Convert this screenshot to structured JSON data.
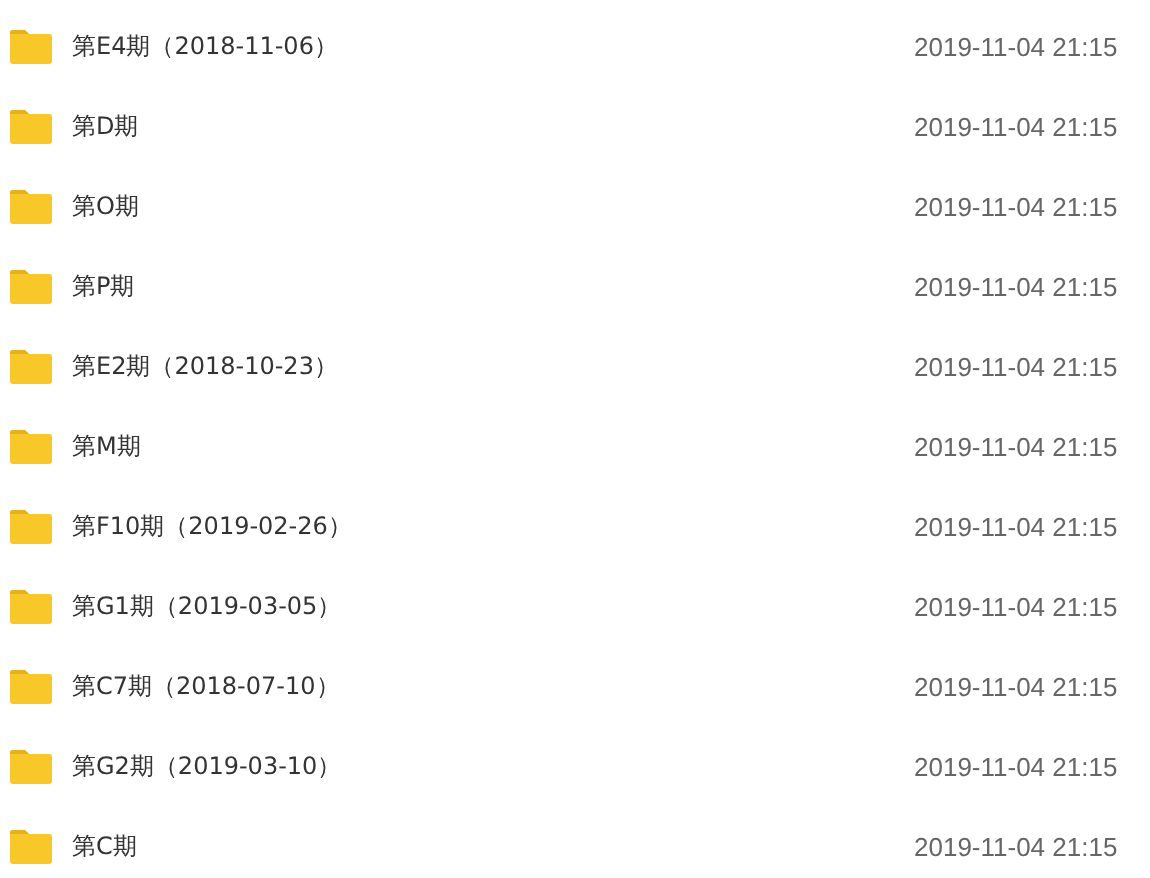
{
  "files": [
    {
      "name": "第E4期（2018-11-06）",
      "modified": "2019-11-04 21:15"
    },
    {
      "name": "第D期",
      "modified": "2019-11-04 21:15"
    },
    {
      "name": "第O期",
      "modified": "2019-11-04 21:15"
    },
    {
      "name": "第P期",
      "modified": "2019-11-04 21:15"
    },
    {
      "name": "第E2期（2018-10-23）",
      "modified": "2019-11-04 21:15"
    },
    {
      "name": "第M期",
      "modified": "2019-11-04 21:15"
    },
    {
      "name": "第F10期（2019-02-26）",
      "modified": "2019-11-04 21:15"
    },
    {
      "name": "第G1期（2019-03-05）",
      "modified": "2019-11-04 21:15"
    },
    {
      "name": "第C7期（2018-07-10）",
      "modified": "2019-11-04 21:15"
    },
    {
      "name": "第G2期（2019-03-10）",
      "modified": "2019-11-04 21:15"
    },
    {
      "name": "第C期",
      "modified": "2019-11-04 21:15"
    }
  ]
}
